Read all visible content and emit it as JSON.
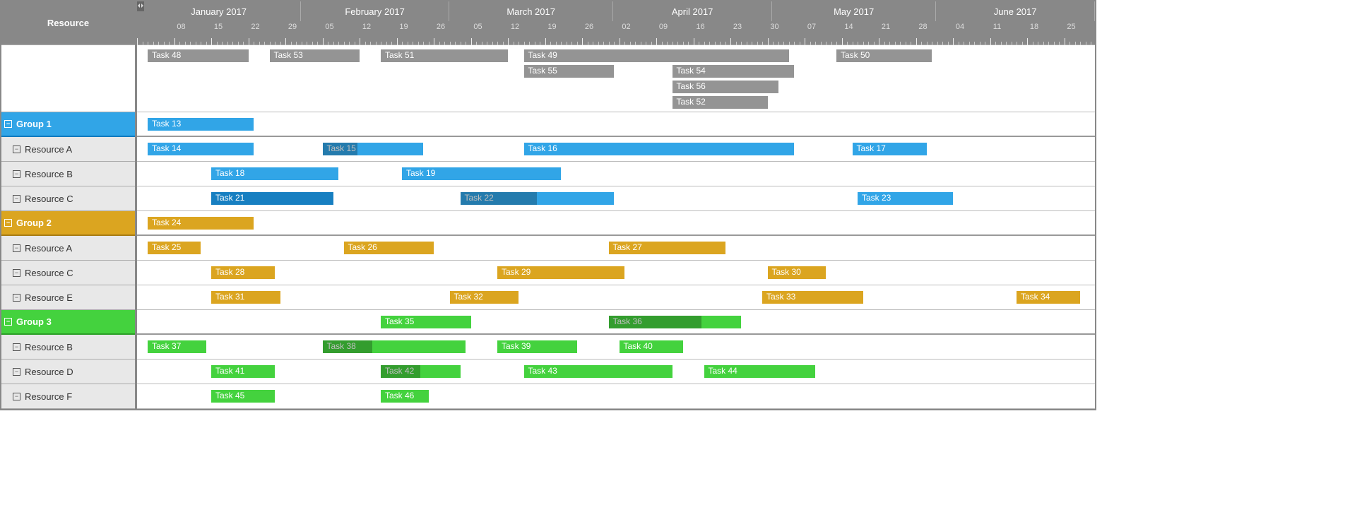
{
  "chart_data": {
    "type": "gantt",
    "timeline": {
      "start": "2017-01-01",
      "end": "2017-06-30",
      "pxPerDay": 7.5,
      "months": [
        {
          "label": "January 2017",
          "start": "2017-01-01",
          "days": 31
        },
        {
          "label": "February 2017",
          "start": "2017-02-01",
          "days": 28
        },
        {
          "label": "March 2017",
          "start": "2017-03-01",
          "days": 31
        },
        {
          "label": "April 2017",
          "start": "2017-04-01",
          "days": 30
        },
        {
          "label": "May 2017",
          "start": "2017-05-01",
          "days": 31
        },
        {
          "label": "June 2017",
          "start": "2017-06-01",
          "days": 30
        }
      ],
      "weekLabels": [
        "08",
        "15",
        "22",
        "29",
        "05",
        "12",
        "19",
        "26",
        "05",
        "12",
        "19",
        "26",
        "02",
        "09",
        "16",
        "23",
        "30",
        "07",
        "14",
        "21",
        "28",
        "04",
        "11",
        "18",
        "25"
      ]
    },
    "columns": {
      "resourceHeader": "Resource"
    },
    "rows": [
      {
        "id": "blank",
        "type": "blank",
        "stacks": [
          [
            {
              "label": "Task 48",
              "start": "2017-01-03",
              "end": "2017-01-22",
              "color": "grey"
            },
            {
              "label": "Task 53",
              "start": "2017-01-26",
              "end": "2017-02-12",
              "color": "grey"
            },
            {
              "label": "Task 51",
              "start": "2017-02-16",
              "end": "2017-03-12",
              "color": "grey"
            },
            {
              "label": "Task 49",
              "start": "2017-03-15",
              "end": "2017-05-04",
              "color": "grey"
            },
            {
              "label": "Task 50",
              "start": "2017-05-13",
              "end": "2017-05-31",
              "color": "grey"
            }
          ],
          [
            {
              "label": "Task 55",
              "start": "2017-03-15",
              "end": "2017-04-01",
              "color": "grey"
            },
            {
              "label": "Task 54",
              "start": "2017-04-12",
              "end": "2017-05-05",
              "color": "grey"
            }
          ],
          [
            {
              "label": "Task 56",
              "start": "2017-04-12",
              "end": "2017-05-02",
              "color": "grey"
            }
          ],
          [
            {
              "label": "Task 52",
              "start": "2017-04-12",
              "end": "2017-04-30",
              "color": "grey"
            }
          ]
        ]
      },
      {
        "id": "g1",
        "type": "group",
        "label": "Group 1",
        "color": "blue",
        "tasks": [
          {
            "label": "Task 13",
            "start": "2017-01-03",
            "end": "2017-01-23",
            "color": "blue"
          }
        ]
      },
      {
        "id": "g1ra",
        "type": "resource",
        "label": "Resource A",
        "tasks": [
          {
            "label": "Task 14",
            "start": "2017-01-03",
            "end": "2017-01-23",
            "color": "blue"
          },
          {
            "label": "Task 15",
            "start": "2017-02-05",
            "end": "2017-02-24",
            "color": "blue",
            "progress": 0.35,
            "progressColor": "blue-d"
          },
          {
            "label": "Task 16",
            "start": "2017-03-15",
            "end": "2017-05-05",
            "color": "blue"
          },
          {
            "label": "Task 17",
            "start": "2017-05-16",
            "end": "2017-05-30",
            "color": "blue"
          }
        ]
      },
      {
        "id": "g1rb",
        "type": "resource",
        "label": "Resource B",
        "tasks": [
          {
            "label": "Task 18",
            "start": "2017-01-15",
            "end": "2017-02-08",
            "color": "blue"
          },
          {
            "label": "Task 19",
            "start": "2017-02-20",
            "end": "2017-03-22",
            "color": "blue"
          }
        ]
      },
      {
        "id": "g1rc",
        "type": "resource",
        "label": "Resource C",
        "tasks": [
          {
            "label": "Task 21",
            "start": "2017-01-15",
            "end": "2017-02-07",
            "color": "blue-d"
          },
          {
            "label": "Task 22",
            "start": "2017-03-03",
            "end": "2017-04-01",
            "color": "blue",
            "progress": 0.5,
            "progressColor": "blue-d"
          },
          {
            "label": "Task 23",
            "start": "2017-05-17",
            "end": "2017-06-04",
            "color": "blue"
          }
        ]
      },
      {
        "id": "g2",
        "type": "group",
        "label": "Group 2",
        "color": "gold",
        "tasks": [
          {
            "label": "Task 24",
            "start": "2017-01-03",
            "end": "2017-01-23",
            "color": "gold"
          }
        ]
      },
      {
        "id": "g2ra",
        "type": "resource",
        "label": "Resource A",
        "tasks": [
          {
            "label": "Task 25",
            "start": "2017-01-03",
            "end": "2017-01-13",
            "color": "gold"
          },
          {
            "label": "Task 26",
            "start": "2017-02-09",
            "end": "2017-02-26",
            "color": "gold"
          },
          {
            "label": "Task 27",
            "start": "2017-03-31",
            "end": "2017-04-22",
            "color": "gold"
          }
        ]
      },
      {
        "id": "g2rc",
        "type": "resource",
        "label": "Resource C",
        "tasks": [
          {
            "label": "Task 28",
            "start": "2017-01-15",
            "end": "2017-01-27",
            "color": "gold"
          },
          {
            "label": "Task 29",
            "start": "2017-03-10",
            "end": "2017-04-03",
            "color": "gold"
          },
          {
            "label": "Task 30",
            "start": "2017-04-30",
            "end": "2017-05-11",
            "color": "gold"
          }
        ]
      },
      {
        "id": "g2re",
        "type": "resource",
        "label": "Resource E",
        "tasks": [
          {
            "label": "Task 31",
            "start": "2017-01-15",
            "end": "2017-01-28",
            "color": "gold"
          },
          {
            "label": "Task 32",
            "start": "2017-03-01",
            "end": "2017-03-14",
            "color": "gold"
          },
          {
            "label": "Task 33",
            "start": "2017-04-29",
            "end": "2017-05-18",
            "color": "gold"
          },
          {
            "label": "Task 34",
            "start": "2017-06-16",
            "end": "2017-06-28",
            "color": "gold"
          }
        ]
      },
      {
        "id": "g3",
        "type": "group",
        "label": "Group 3",
        "color": "green",
        "tasks": [
          {
            "label": "Task 35",
            "start": "2017-02-16",
            "end": "2017-03-05",
            "color": "green"
          },
          {
            "label": "Task 36",
            "start": "2017-03-31",
            "end": "2017-04-25",
            "color": "green",
            "progress": 0.7,
            "progressColor": "green-d"
          }
        ]
      },
      {
        "id": "g3rb",
        "type": "resource",
        "label": "Resource B",
        "tasks": [
          {
            "label": "Task 37",
            "start": "2017-01-03",
            "end": "2017-01-14",
            "color": "green"
          },
          {
            "label": "Task 38",
            "start": "2017-02-05",
            "end": "2017-03-04",
            "color": "green",
            "progress": 0.35,
            "progressColor": "green-d"
          },
          {
            "label": "Task 39",
            "start": "2017-03-10",
            "end": "2017-03-25",
            "color": "green"
          },
          {
            "label": "Task 40",
            "start": "2017-04-02",
            "end": "2017-04-14",
            "color": "green"
          }
        ]
      },
      {
        "id": "g3rd",
        "type": "resource",
        "label": "Resource D",
        "tasks": [
          {
            "label": "Task 41",
            "start": "2017-01-15",
            "end": "2017-01-27",
            "color": "green"
          },
          {
            "label": "Task 42",
            "start": "2017-02-16",
            "end": "2017-03-03",
            "color": "green",
            "progress": 0.5,
            "progressColor": "green-d"
          },
          {
            "label": "Task 43",
            "start": "2017-03-15",
            "end": "2017-04-12",
            "color": "green"
          },
          {
            "label": "Task 44",
            "start": "2017-04-18",
            "end": "2017-05-09",
            "color": "green"
          }
        ]
      },
      {
        "id": "g3rf",
        "type": "resource",
        "label": "Resource F",
        "tasks": [
          {
            "label": "Task 45",
            "start": "2017-01-15",
            "end": "2017-01-27",
            "color": "green"
          },
          {
            "label": "Task 46",
            "start": "2017-02-16",
            "end": "2017-02-25",
            "color": "green"
          }
        ]
      }
    ]
  }
}
